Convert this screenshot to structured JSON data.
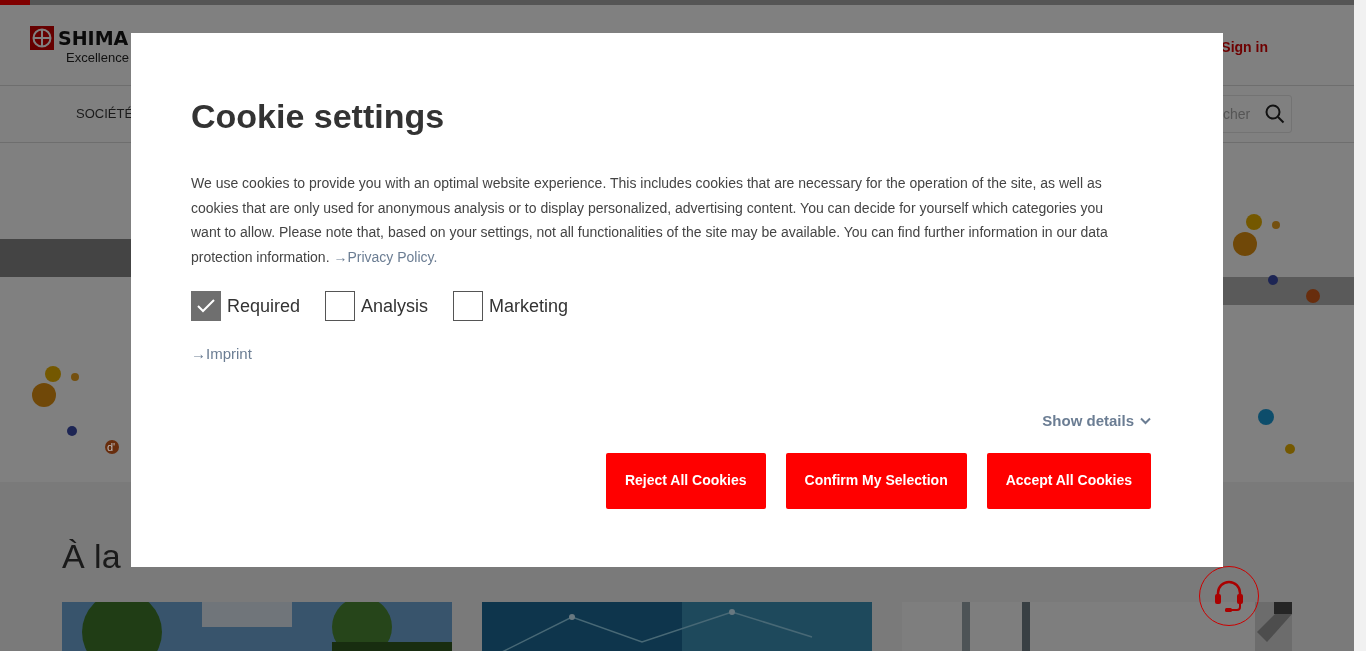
{
  "header": {
    "logo_text": "SHIMA",
    "tagline": "Excellence",
    "sign_in": "Sign in"
  },
  "nav": {
    "items": [
      {
        "label": "SOCIÉTÉ"
      }
    ],
    "search": {
      "placeholder": "cher"
    }
  },
  "hero": {
    "dot_label": "d'"
  },
  "news": {
    "heading": "À la"
  },
  "cookie_dialog": {
    "title": "Cookie settings",
    "text": "We use cookies to provide you with an optimal website experience. This includes cookies that are necessary for the operation of the site, as well as cookies that are only used for anonymous analysis or to display personalized, advertising content. You can decide for yourself which categories you want to allow. Please note that, based on your settings, not all functionalities of the site may be available. You can find further information in our data protection information. ",
    "privacy_link": "→Privacy Policy.",
    "categories": [
      {
        "label": "Required",
        "checked": true
      },
      {
        "label": "Analysis",
        "checked": false
      },
      {
        "label": "Marketing",
        "checked": false
      }
    ],
    "imprint_link": "→Imprint",
    "details": {
      "label": "Show details",
      "expanded": false
    },
    "buttons": [
      "Reject All Cookies",
      "Confirm My Selection",
      "Accept All Cookies"
    ]
  }
}
